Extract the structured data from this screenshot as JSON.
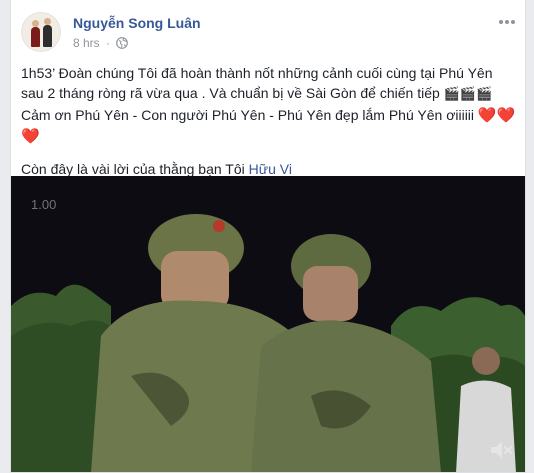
{
  "post": {
    "author": "Nguyễn Song Luân",
    "time": "8 hrs",
    "separator": "·",
    "more_icon": "more-icon",
    "privacy_icon": "globe-icon"
  },
  "text": {
    "line1": "1h53’ Đoàn chúng Tôi đã hoàn thành nốt những cảnh cuối cùng tại Phú Yên sau 2 tháng ròng rã vừa qua . Và chuẩn bị về Sài Gòn để chiến tiếp ",
    "clap": "🎬🎬🎬",
    "line2": "Cảm ơn Phú Yên - Con người Phú Yên - Phú Yên đẹp lắm Phú Yên ơiiiiii ",
    "hearts": "❤️❤️❤️",
    "line3_prefix": "Còn đây là vài lời của thằng bạn Tôi ",
    "mention": "Hữu Vi"
  },
  "video": {
    "timer": "1.00",
    "mute_icon": "speaker-muted-icon"
  },
  "colors": {
    "link": "#385898",
    "meta": "#90949c",
    "text": "#1d2129",
    "heart": "#f25268",
    "page_bg": "#e9ebee"
  }
}
